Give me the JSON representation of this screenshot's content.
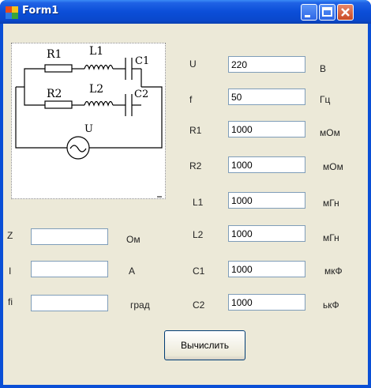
{
  "window": {
    "title": "Form1"
  },
  "diagram": {
    "labels": {
      "r1": "R1",
      "r2": "R2",
      "l1": "L1",
      "l2": "L2",
      "c1": "C1",
      "c2": "C2",
      "u": "U"
    }
  },
  "inputs": [
    {
      "label": "U",
      "value": "220",
      "unit": "В"
    },
    {
      "label": "f",
      "value": "50",
      "unit": "Гц"
    },
    {
      "label": "R1",
      "value": "1000",
      "unit": "мОм"
    },
    {
      "label": "R2",
      "value": "1000",
      "unit": "мОм"
    },
    {
      "label": "L1",
      "value": "1000",
      "unit": "мГн"
    },
    {
      "label": "L2",
      "value": "1000",
      "unit": "мГн"
    },
    {
      "label": "C1",
      "value": "1000",
      "unit": "мкФ"
    },
    {
      "label": "C2",
      "value": "1000",
      "unit": "ькФ"
    }
  ],
  "outputs": [
    {
      "label": "Z",
      "value": "",
      "unit": "Ом"
    },
    {
      "label": "I",
      "value": "",
      "unit": "А"
    },
    {
      "label": "fi",
      "value": "",
      "unit": "град"
    }
  ],
  "calculate_button": "Вычислить"
}
